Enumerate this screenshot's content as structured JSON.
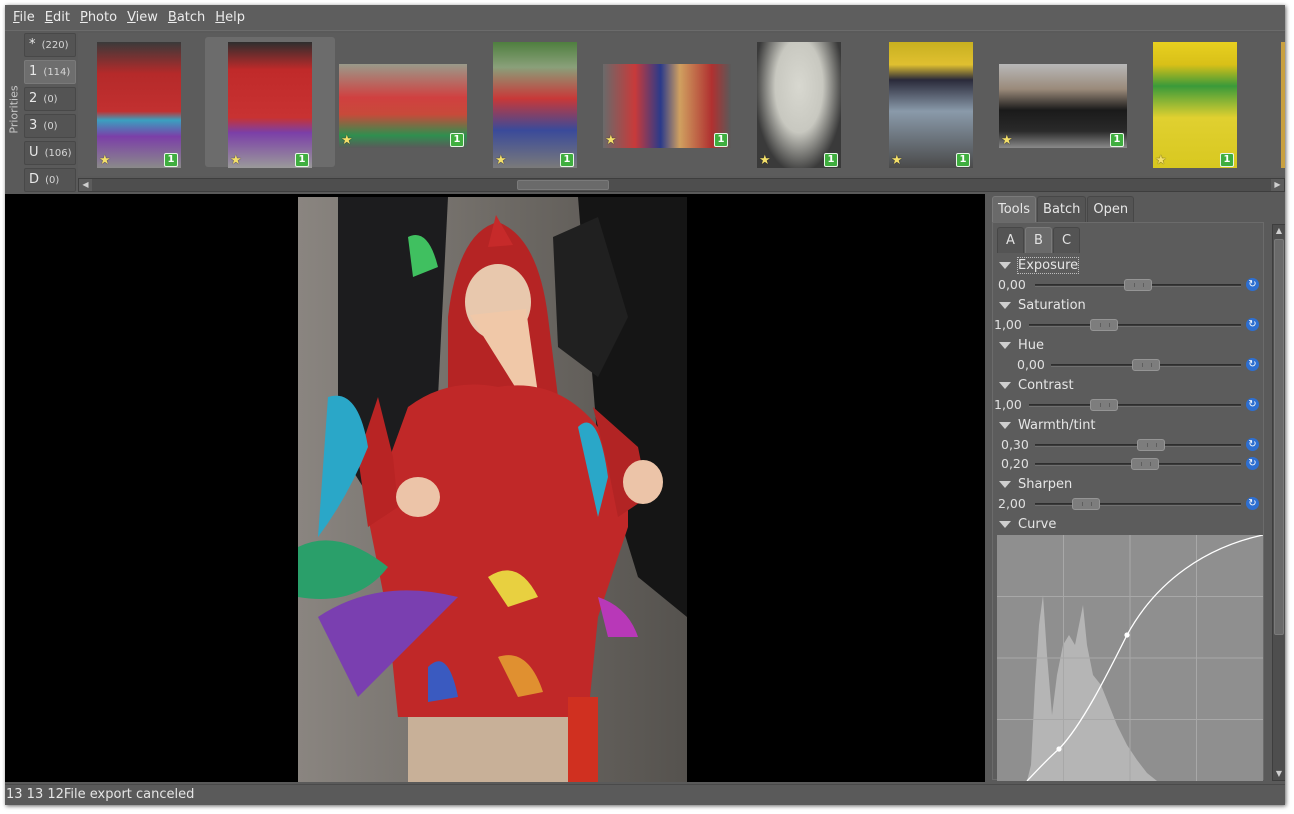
{
  "menubar": {
    "items": [
      {
        "mnemonic": "F",
        "rest": "ile"
      },
      {
        "mnemonic": "E",
        "rest": "dit"
      },
      {
        "mnemonic": "P",
        "rest": "hoto"
      },
      {
        "mnemonic": "V",
        "rest": "iew"
      },
      {
        "mnemonic": "B",
        "rest": "atch"
      },
      {
        "mnemonic": "H",
        "rest": "elp"
      }
    ]
  },
  "filmstrip": {
    "side_label": "Priorities",
    "priorities": [
      {
        "label": "*",
        "count": "(220)"
      },
      {
        "label": "1",
        "count": "(114)"
      },
      {
        "label": "2",
        "count": "(0)"
      },
      {
        "label": "3",
        "count": "(0)"
      },
      {
        "label": "U",
        "count": "(106)"
      },
      {
        "label": "D",
        "count": "(0)"
      }
    ],
    "thumbnails": [
      {
        "star": "★",
        "priority": "1"
      },
      {
        "star": "★",
        "priority": "1"
      },
      {
        "star": "★",
        "priority": "1"
      },
      {
        "star": "★",
        "priority": "1"
      },
      {
        "star": "★",
        "priority": "1"
      },
      {
        "star": "★",
        "priority": "1"
      },
      {
        "star": "★",
        "priority": "1"
      },
      {
        "star": "★",
        "priority": "1"
      },
      {
        "star": "★",
        "priority": "1"
      }
    ]
  },
  "panel": {
    "tabs": [
      "Tools",
      "Batch",
      "Open"
    ],
    "subtabs": [
      "A",
      "B",
      "C"
    ],
    "tools": {
      "exposure": {
        "label": "Exposure",
        "value": "0,00"
      },
      "saturation": {
        "label": "Saturation",
        "value": "1,00"
      },
      "hue": {
        "label": "Hue",
        "value": "0,00"
      },
      "contrast": {
        "label": "Contrast",
        "value": "1,00"
      },
      "warmth": {
        "label": "Warmth/tint",
        "value": "0,30",
        "tint": "0,20"
      },
      "sharpen": {
        "label": "Sharpen",
        "value": "2,00"
      },
      "curve": {
        "label": "Curve"
      }
    },
    "reset_icon": "reset-icon"
  },
  "statusbar": {
    "text": "13 13 12File export canceled"
  }
}
